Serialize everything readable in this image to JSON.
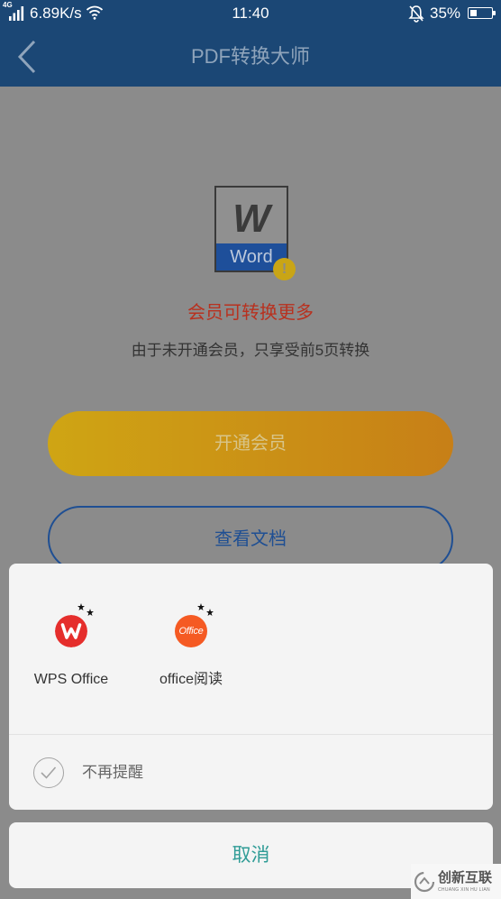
{
  "status_bar": {
    "network_type": "4G",
    "speed": "6.89K/s",
    "time": "11:40",
    "battery_text": "35%",
    "battery_level": 0.35,
    "icons": [
      "signal-icon",
      "wifi-icon",
      "bell-mute-icon",
      "battery-icon"
    ]
  },
  "header": {
    "title": "PDF转换大师",
    "back_icon": "chevron-left-icon"
  },
  "main": {
    "document_icon": {
      "letter": "W",
      "label": "Word",
      "badge": "!"
    },
    "promo_title": "会员可转换更多",
    "promo_description": "由于未开通会员，只享受前5页转换",
    "vip_button_label": "开通会员",
    "view_document_label": "查看文档"
  },
  "open_with_sheet": {
    "apps": [
      {
        "label": "WPS Office",
        "icon": "wps-office-icon",
        "logo_text": "W"
      },
      {
        "label": "office阅读",
        "icon": "office-reader-icon",
        "logo_text": "Office"
      }
    ],
    "dont_remind_label": "不再提醒",
    "cancel_label": "取消"
  },
  "watermark": {
    "title": "创新互联",
    "subtitle": "CHUANG XIN HU LIAN"
  },
  "colors": {
    "header_bg": "#1b4775",
    "dim_background": "#8b8b8b",
    "promo_red": "#b8311f",
    "vip_gradient_start": "#cfa514",
    "vip_gradient_end": "#c77f17",
    "outline_blue": "#1f4f93",
    "sheet_bg": "#f4f4f4",
    "cancel_teal": "#2f9c96",
    "wps_red": "#e52e2c",
    "office_orange": "#f55a23"
  }
}
